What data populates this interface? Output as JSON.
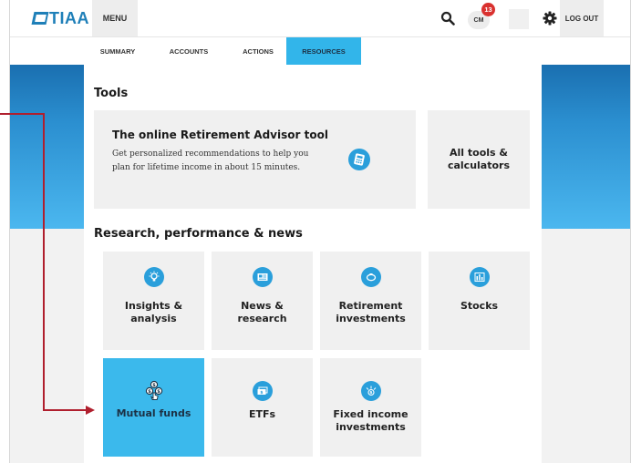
{
  "header": {
    "brand": "TIAA",
    "menu_label": "MENU",
    "avatar_initials": "CM",
    "notification_count": "13",
    "logout_label": "LOG OUT"
  },
  "tabs": [
    {
      "label": "SUMMARY",
      "active": false
    },
    {
      "label": "ACCOUNTS",
      "active": false
    },
    {
      "label": "ACTIONS",
      "active": false
    },
    {
      "label": "RESOURCES",
      "active": true
    }
  ],
  "tools": {
    "title": "Tools",
    "advisor": {
      "title": "The online Retirement Advisor tool",
      "description": "Get personalized recommendations to help you plan for lifetime income in about 15 minutes.",
      "icon": "calculator-icon"
    },
    "all_tools_label": "All tools &\ncalculators"
  },
  "research": {
    "title": "Research, performance & news",
    "cards": [
      {
        "label": "Insights &\nanalysis",
        "icon": "lightbulb-icon"
      },
      {
        "label": "News &\nresearch",
        "icon": "newspaper-icon"
      },
      {
        "label": "Retirement\ninvestments",
        "icon": "piggy-bank-icon"
      },
      {
        "label": "Stocks",
        "icon": "bar-chart-icon"
      },
      {
        "label": "Mutual funds",
        "icon": "coins-icon"
      },
      {
        "label": "ETFs",
        "icon": "cash-stack-icon"
      },
      {
        "label": "Fixed income\ninvestments",
        "icon": "dollar-arrows-icon"
      }
    ]
  },
  "colors": {
    "accent": "#32b5ea",
    "brand": "#1e7fb8",
    "icon_blue": "#2a9fdb",
    "badge": "#d9312f",
    "callout": "#b01f2e"
  }
}
